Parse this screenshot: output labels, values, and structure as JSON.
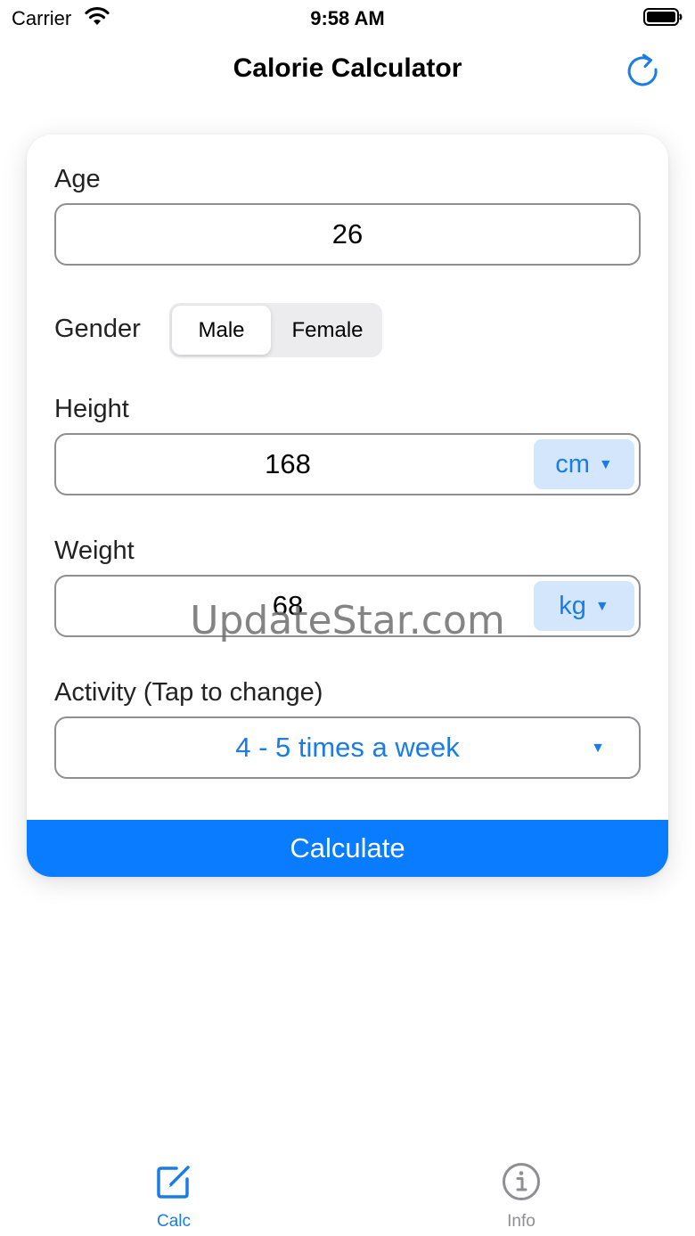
{
  "status_bar": {
    "carrier": "Carrier",
    "time": "9:58 AM"
  },
  "nav": {
    "title": "Calorie Calculator",
    "refresh_icon": "refresh-icon"
  },
  "form": {
    "age": {
      "label": "Age",
      "value": "26"
    },
    "gender": {
      "label": "Gender",
      "options": [
        "Male",
        "Female"
      ],
      "selected": "Male"
    },
    "height": {
      "label": "Height",
      "value": "168",
      "unit": "cm"
    },
    "weight": {
      "label": "Weight",
      "value": "68",
      "unit": "kg"
    },
    "activity": {
      "label": "Activity (Tap to change)",
      "value": "4 - 5 times a week"
    },
    "calculate_label": "Calculate"
  },
  "watermark": "UpdateStar.com",
  "tabs": [
    {
      "label": "Calc",
      "icon": "edit-icon",
      "active": true
    },
    {
      "label": "Info",
      "icon": "info-icon",
      "active": false
    }
  ],
  "colors": {
    "accent": "#0a7cff",
    "link": "#1a7ce6",
    "unit_bg": "#d3e6fb",
    "inactive": "#8e8e93"
  }
}
